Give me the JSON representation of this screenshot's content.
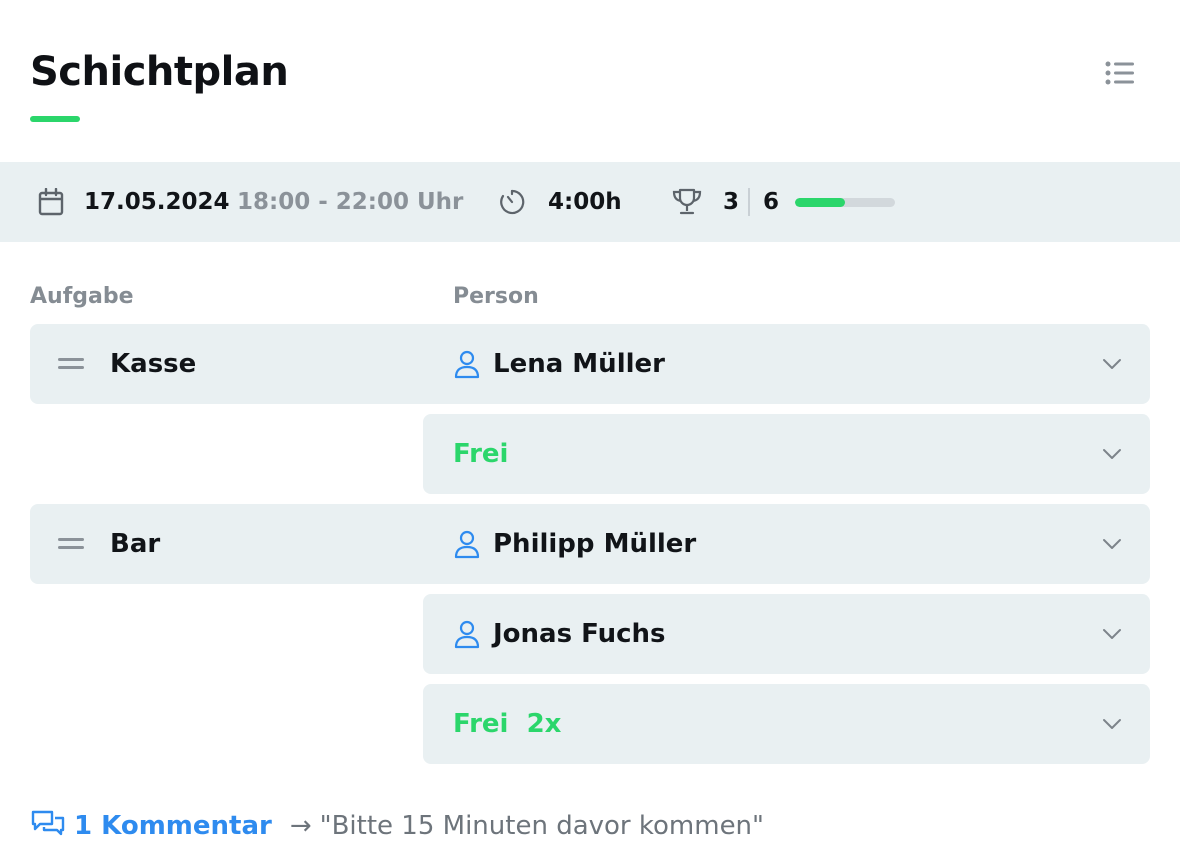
{
  "header": {
    "title": "Schichtplan"
  },
  "info": {
    "date": "17.05.2024",
    "time_range": "18:00 - 22:00 Uhr",
    "duration": "4:00h",
    "filled": "3",
    "total": "6",
    "progress_fraction": 0.5
  },
  "columns": {
    "task": "Aufgabe",
    "person": "Person"
  },
  "tasks": [
    {
      "name": "Kasse",
      "slots": [
        {
          "type": "person",
          "label": "Lena Müller"
        },
        {
          "type": "free",
          "label": "Frei"
        }
      ]
    },
    {
      "name": "Bar",
      "slots": [
        {
          "type": "person",
          "label": "Philipp Müller"
        },
        {
          "type": "person",
          "label": "Jonas Fuchs"
        },
        {
          "type": "free",
          "label": "Frei  2x"
        }
      ]
    }
  ],
  "comment": {
    "count_label": "1 Kommentar",
    "arrow": "→",
    "quote": "\"Bitte 15 Minuten davor kommen\""
  },
  "colors": {
    "accent_green": "#2bd66b",
    "link_blue": "#2e8bef",
    "row_bg": "#e9f0f2"
  },
  "icons": {
    "menu": "list-icon",
    "date": "calendar-icon",
    "duration": "timer-icon",
    "score": "trophy-icon",
    "person": "user-icon",
    "dropdown": "chevron-down-icon",
    "comment": "comment-icon"
  }
}
